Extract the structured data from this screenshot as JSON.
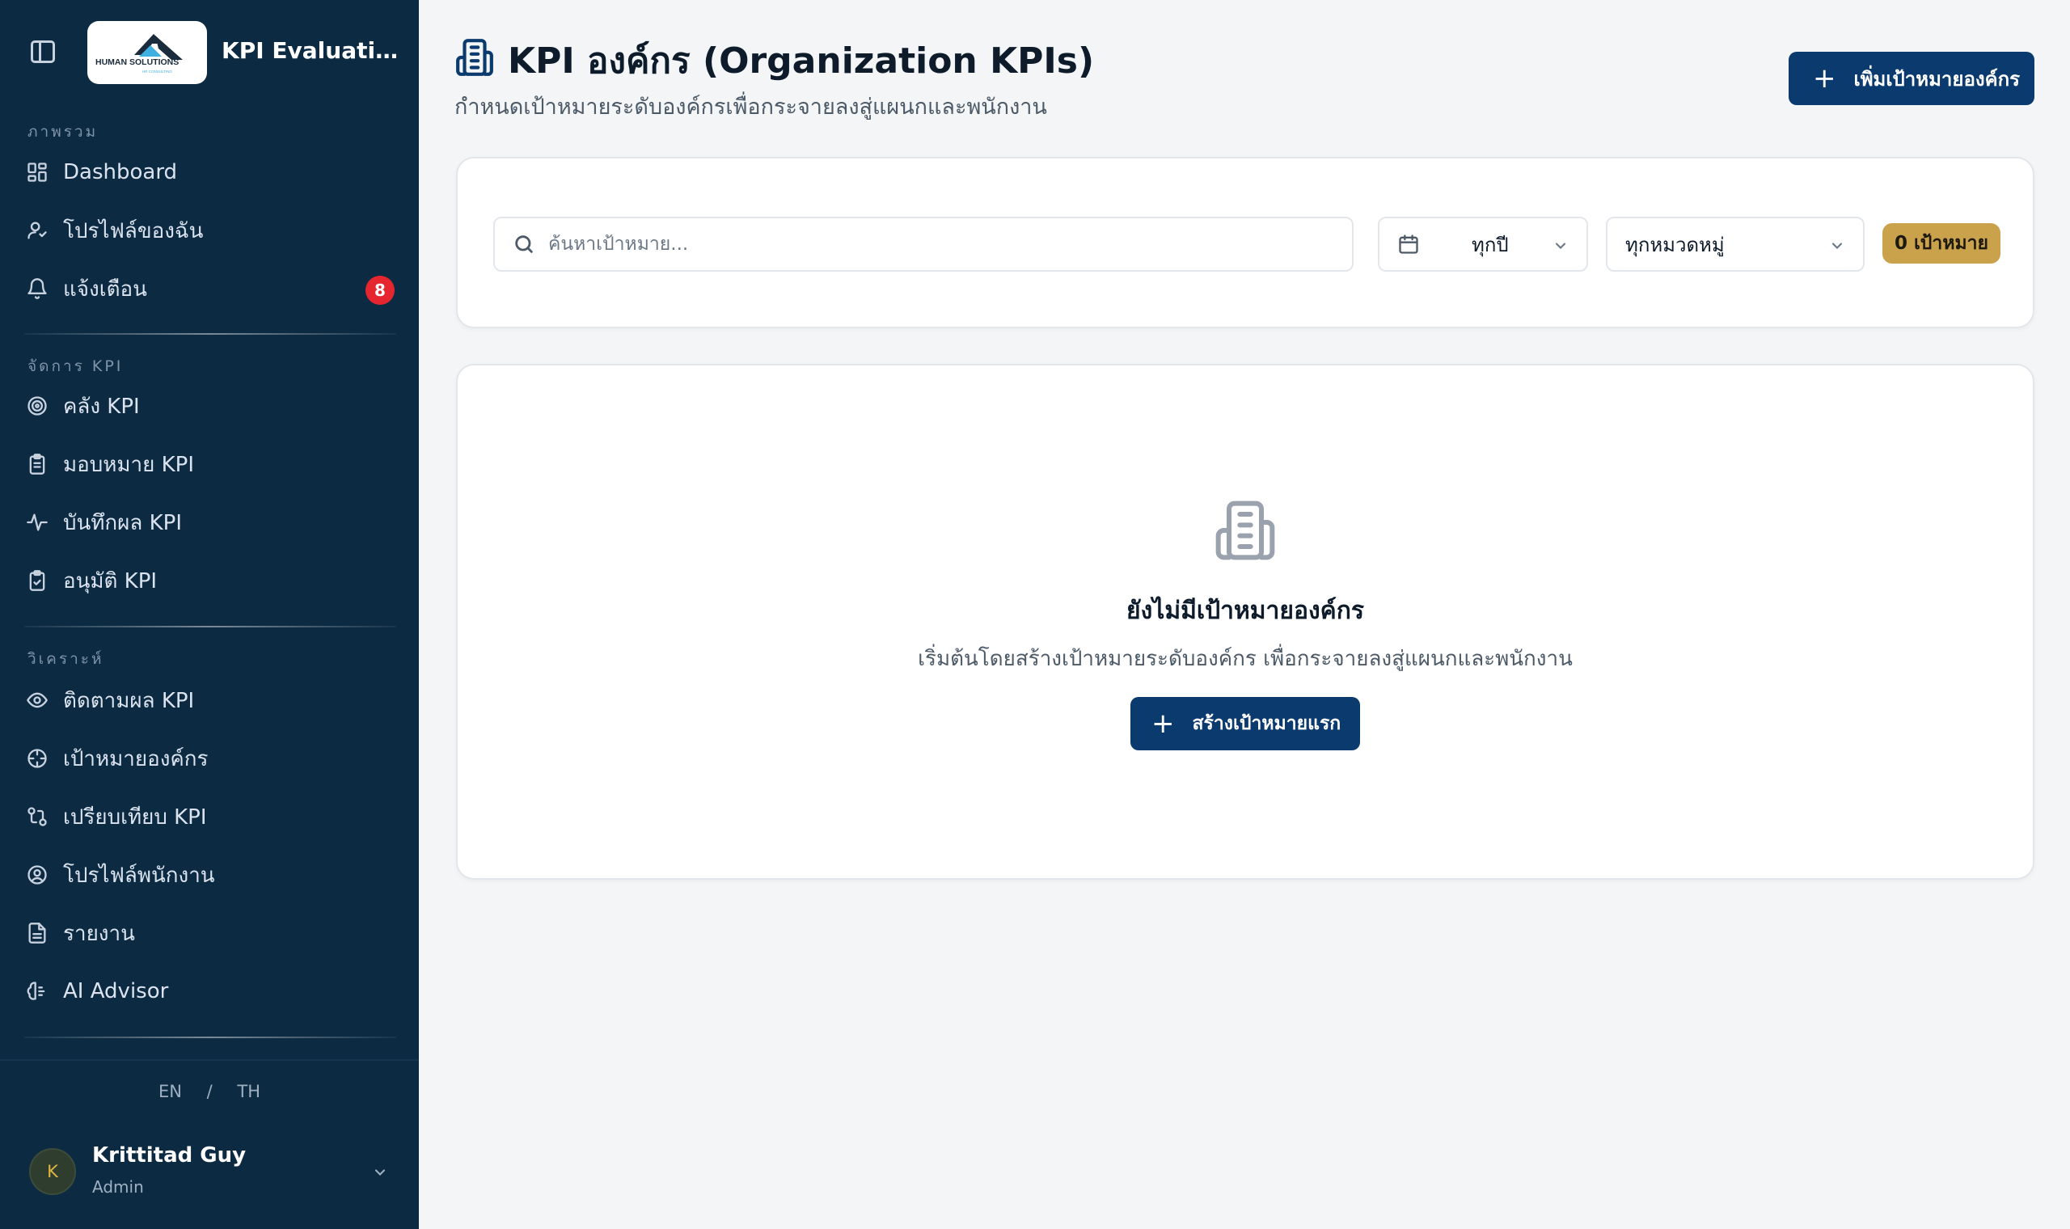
{
  "app": {
    "title": "KPI Evaluation ...",
    "logo_text": "HUMAN SOLUTIONS",
    "logo_subtext": "HR CONSULTING"
  },
  "sidebar": {
    "sections": [
      {
        "label": "ภาพรวม"
      },
      {
        "label": "จัดการ KPI"
      },
      {
        "label": "วิเคราะห์"
      }
    ],
    "items": [
      {
        "label": "Dashboard",
        "icon": "dashboard-icon"
      },
      {
        "label": "โปรไฟล์ของฉัน",
        "icon": "user-icon"
      },
      {
        "label": "แจ้งเตือน",
        "icon": "bell-icon",
        "badge": "8"
      },
      {
        "label": "คลัง KPI",
        "icon": "target-icon"
      },
      {
        "label": "มอบหมาย KPI",
        "icon": "clipboard-list-icon"
      },
      {
        "label": "บันทึกผล KPI",
        "icon": "activity-icon"
      },
      {
        "label": "อนุมัติ KPI",
        "icon": "clipboard-check-icon"
      },
      {
        "label": "ติดตามผล KPI",
        "icon": "eye-icon"
      },
      {
        "label": "เป้าหมายองค์กร",
        "icon": "crosshair-icon"
      },
      {
        "label": "เปรียบเทียบ KPI",
        "icon": "compare-icon"
      },
      {
        "label": "โปรไฟล์พนักงาน",
        "icon": "user-circle-icon"
      },
      {
        "label": "รายงาน",
        "icon": "file-text-icon"
      },
      {
        "label": "AI Advisor",
        "icon": "brain-icon"
      }
    ],
    "lang": {
      "en": "EN",
      "sep": "/",
      "th": "TH"
    },
    "user": {
      "initial": "K",
      "name": "Krittitad Guy",
      "role": "Admin"
    }
  },
  "header": {
    "title": "KPI องค์กร (Organization KPIs)",
    "subtitle": "กำหนดเป้าหมายระดับองค์กรเพื่อกระจายลงสู่แผนกและพนักงาน",
    "add_button": "เพิ่มเป้าหมายองค์กร"
  },
  "filters": {
    "search_placeholder": "ค้นหาเป้าหมาย...",
    "search_value": "",
    "year_value": "ทุกปี",
    "category_value": "ทุกหมวดหมู่",
    "count_label": "0 เป้าหมาย"
  },
  "empty_state": {
    "title": "ยังไม่มีเป้าหมายองค์กร",
    "subtitle": "เริ่มต้นโดยสร้างเป้าหมายระดับองค์กร เพื่อกระจายลงสู่แผนกและพนักงาน",
    "button": "สร้างเป้าหมายแรก"
  },
  "colors": {
    "sidebar_bg": "#0c2a42",
    "primary": "#0b3a6e",
    "accent_gold": "#c9a24b",
    "badge_red": "#e5262f",
    "page_bg": "#f3f5f7"
  }
}
